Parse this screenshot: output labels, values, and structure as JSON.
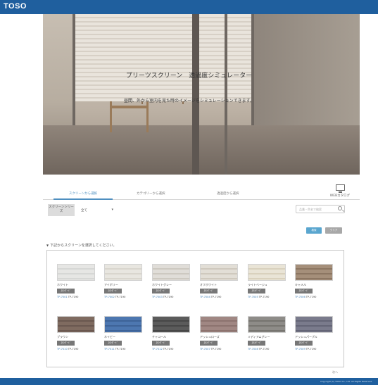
{
  "header": {
    "logo": "TOSO"
  },
  "hero": {
    "title": "プリーツスクリーン　透過度シミュレーター",
    "subtitle": "昼間、外から室内を見た時のイメージをシミュレーションできます。"
  },
  "tabs": [
    {
      "label": "スクリーンから選択"
    },
    {
      "label": "カテゴリーから選択"
    },
    {
      "label": "透過度から選択"
    }
  ],
  "catalog_link": {
    "label": "WEBカタログ",
    "icon": "monitor-icon"
  },
  "filter": {
    "chip_label": "スクリーンシリーズ",
    "select_value": "全て",
    "search_placeholder": "品番・色名で検索",
    "buttons": [
      "検索",
      "クリア"
    ]
  },
  "instruction": "下記からスクリーンを選択してください。",
  "colors": {
    "brand": "#1f5f9e",
    "accent": "#4e8fc0",
    "badge": "#777777",
    "code_blue": "#3e7fb7"
  },
  "cards": [
    {
      "name": "ホワイト",
      "badge": "ｽﾀﾝﾀﾞｰﾄﾞ",
      "code1": "TP-7001",
      "code2": "TP-7190",
      "swatch": "#e6e6e4",
      "stripe": "#d6d7d5"
    },
    {
      "name": "アイボリー",
      "badge": "ｽﾀﾝﾀﾞｰﾄﾞ",
      "code1": "TP-7002",
      "code2": "TP-7190",
      "swatch": "#e8e6e0",
      "stripe": "#d9d6ce"
    },
    {
      "name": "ホワイトグレー",
      "badge": "ｽﾀﾝﾀﾞｰﾄﾞ",
      "code1": "TP-7003",
      "code2": "TP-7190",
      "swatch": "#e0ddd8",
      "stripe": "#cdc9c1"
    },
    {
      "name": "オフホワイト",
      "badge": "ｽﾀﾝﾀﾞｰﾄﾞ",
      "code1": "TP-7004",
      "code2": "TP-7190",
      "swatch": "#e2ded6",
      "stripe": "#cfc9be"
    },
    {
      "name": "ライトベージュ",
      "badge": "ｽﾀﾝﾀﾞｰﾄﾞ",
      "code1": "TP-7005",
      "code2": "TP-7190",
      "swatch": "#e9e4d6",
      "stripe": "#d9d1bd"
    },
    {
      "name": "キャメル",
      "badge": "ｽﾀﾝﾀﾞｰﾄﾞ",
      "code1": "TP-7006",
      "code2": "TP-7190",
      "swatch": "#a58f7a",
      "stripe": "#8c7662"
    },
    {
      "name": "ブラウン",
      "badge": "ｽﾀﾝﾀﾞｰﾄﾞ",
      "code1": "TP-7010",
      "code2": "TP-7190",
      "swatch": "#7f6b60",
      "stripe": "#6a5850"
    },
    {
      "name": "ネイビー",
      "badge": "ｽﾀﾝﾀﾞｰﾄﾞ",
      "code1": "TP-7011",
      "code2": "TP-7190",
      "swatch": "#4d77b0",
      "stripe": "#3e6398"
    },
    {
      "name": "チャコール",
      "badge": "ｽﾀﾝﾀﾞｰﾄﾞ",
      "code1": "TP-7012",
      "code2": "TP-7190",
      "swatch": "#5b5b5b",
      "stripe": "#474747"
    },
    {
      "name": "アッシュローズ",
      "badge": "ｽﾀﾝﾀﾞｰﾄﾞ",
      "code1": "TP-7007",
      "code2": "TP-7190",
      "swatch": "#a08783",
      "stripe": "#8c736f"
    },
    {
      "name": "ミディアムグレー",
      "badge": "ｽﾀﾝﾀﾞｰﾄﾞ",
      "code1": "TP-7008",
      "code2": "TP-7190",
      "swatch": "#8e8c88",
      "stripe": "#777570"
    },
    {
      "name": "アッシュパープル",
      "badge": "ｽﾀﾝﾀﾞｰﾄﾞ",
      "code1": "TP-7009",
      "code2": "TP-7190",
      "swatch": "#7a7b8c",
      "stripe": "#646576"
    }
  ],
  "pager": "次へ",
  "footer": "Copyright (C) TOSO Co., Ltd. All Rights Reserved."
}
